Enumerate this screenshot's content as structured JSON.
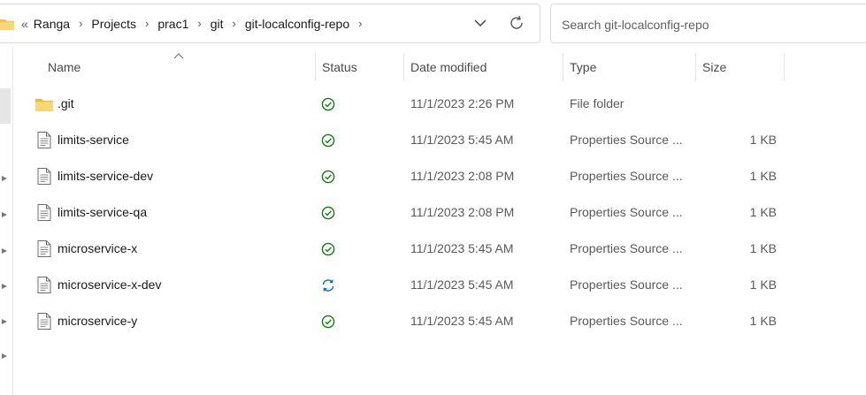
{
  "address": {
    "overflow": "«",
    "crumbs": [
      "Ranga",
      "Projects",
      "prac1",
      "git",
      "git-localconfig-repo"
    ]
  },
  "search": {
    "placeholder": "Search git-localconfig-repo"
  },
  "columns": {
    "name": "Name",
    "status": "Status",
    "date": "Date modified",
    "type": "Type",
    "size": "Size"
  },
  "files": [
    {
      "name": ".git",
      "status": "synced",
      "date": "11/1/2023 2:26 PM",
      "type": "File folder",
      "size": "",
      "icon": "folder-icon"
    },
    {
      "name": "limits-service",
      "status": "synced",
      "date": "11/1/2023 5:45 AM",
      "type": "Properties Source ...",
      "size": "1 KB",
      "icon": "file-icon"
    },
    {
      "name": "limits-service-dev",
      "status": "synced",
      "date": "11/1/2023 2:08 PM",
      "type": "Properties Source ...",
      "size": "1 KB",
      "icon": "file-icon"
    },
    {
      "name": "limits-service-qa",
      "status": "synced",
      "date": "11/1/2023 2:08 PM",
      "type": "Properties Source ...",
      "size": "1 KB",
      "icon": "file-icon"
    },
    {
      "name": "microservice-x",
      "status": "synced",
      "date": "11/1/2023 5:45 AM",
      "type": "Properties Source ...",
      "size": "1 KB",
      "icon": "file-icon"
    },
    {
      "name": "microservice-x-dev",
      "status": "syncing",
      "date": "11/1/2023 5:45 AM",
      "type": "Properties Source ...",
      "size": "1 KB",
      "icon": "file-icon"
    },
    {
      "name": "microservice-y",
      "status": "synced",
      "date": "11/1/2023 5:45 AM",
      "type": "Properties Source ...",
      "size": "1 KB",
      "icon": "file-icon"
    }
  ],
  "colors": {
    "synced": "#107c10",
    "syncing": "#0f6cbd",
    "folder": "#f8d775"
  }
}
